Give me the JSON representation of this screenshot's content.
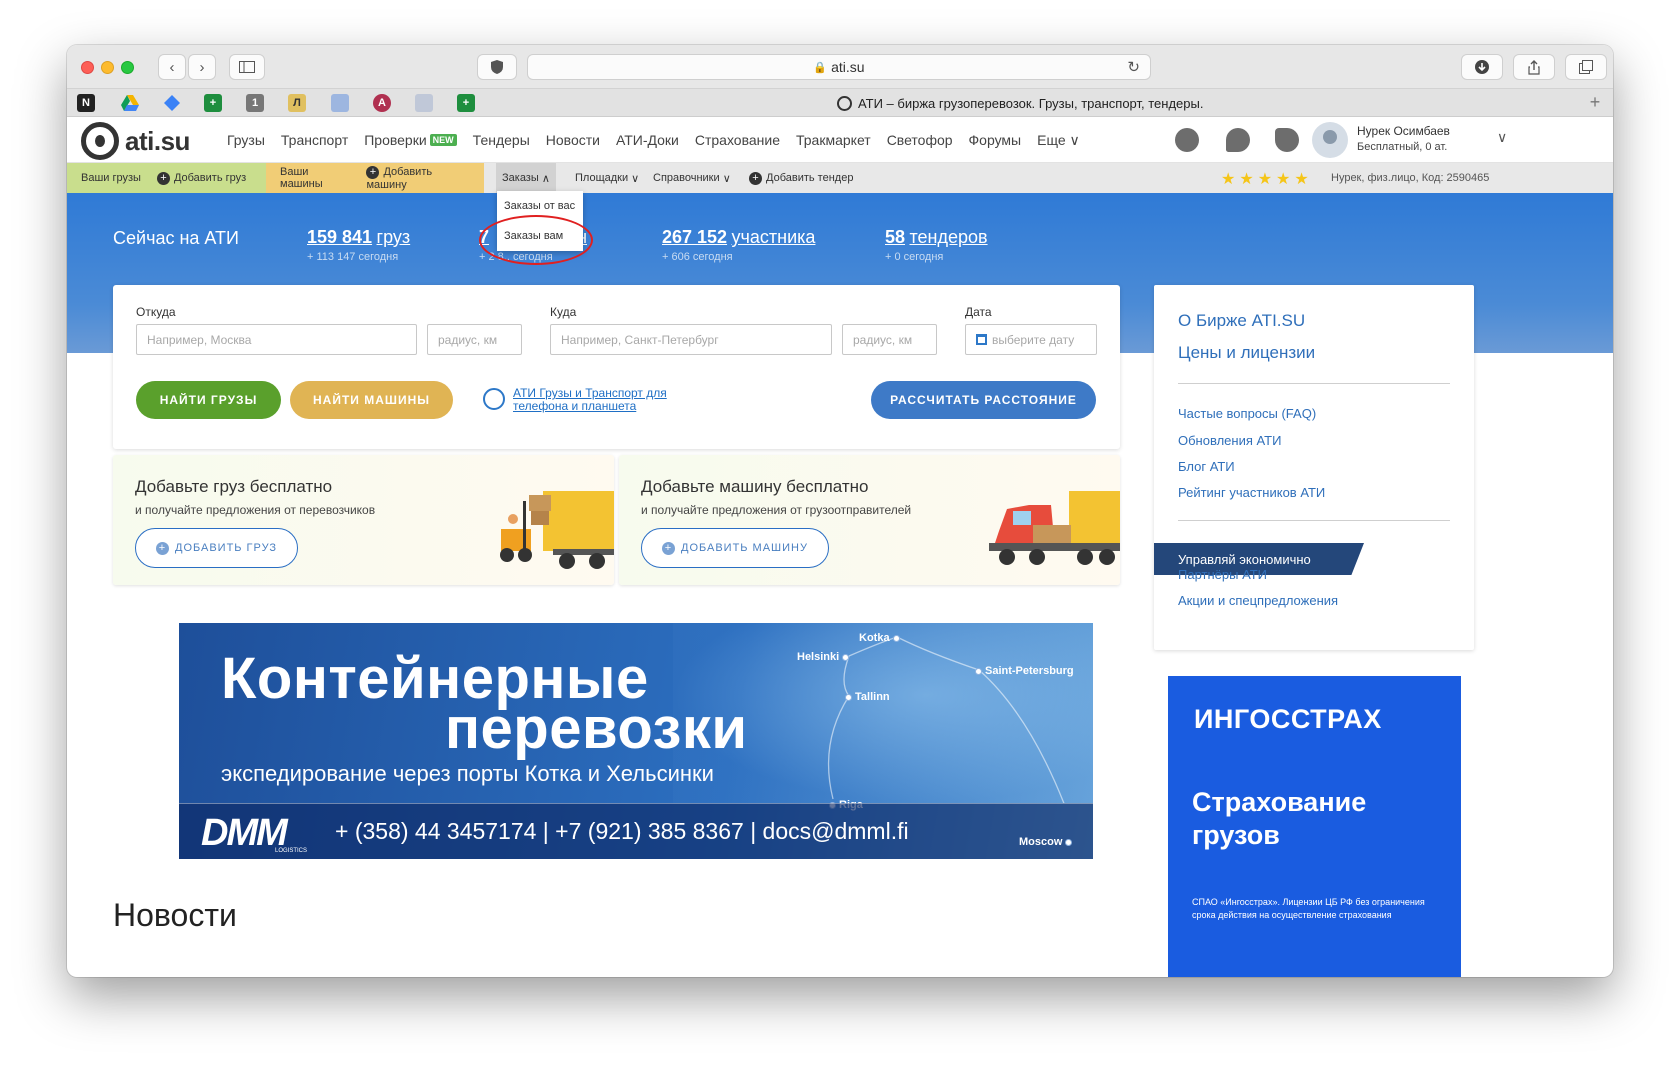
{
  "browser": {
    "url": "ati.su",
    "tab_title": "АТИ – биржа грузоперевозок. Грузы, транспорт, тендеры.",
    "bookmarks": [
      {
        "icon": "notion-icon",
        "label": "N",
        "color": "#222222"
      },
      {
        "icon": "google-drive-icon",
        "label": "",
        "color": "#f4b400"
      },
      {
        "icon": "diamond-icon",
        "label": "",
        "color": "#3b82f6"
      },
      {
        "icon": "sheets-icon",
        "label": "+",
        "color": "#1e8e3e"
      },
      {
        "icon": "numeric-icon",
        "label": "1",
        "color": "#777777"
      },
      {
        "icon": "letter-icon",
        "label": "Л",
        "color": "#e0c060"
      },
      {
        "icon": "grid-icon",
        "label": "",
        "color": "#9db6e0"
      },
      {
        "icon": "a-icon",
        "label": "A",
        "color": "#b03050"
      },
      {
        "icon": "doc-icon",
        "label": "",
        "color": "#c0c8d8"
      },
      {
        "icon": "sheets-icon",
        "label": "+",
        "color": "#1e8e3e"
      }
    ]
  },
  "header": {
    "logo_text": "ati.su",
    "nav": [
      {
        "label": "Грузы",
        "badge": ""
      },
      {
        "label": "Транспорт",
        "badge": ""
      },
      {
        "label": "Проверки",
        "badge": "NEW"
      },
      {
        "label": "Тендеры",
        "badge": ""
      },
      {
        "label": "Новости",
        "badge": ""
      },
      {
        "label": "АТИ-Доки",
        "badge": ""
      },
      {
        "label": "Страхование",
        "badge": ""
      },
      {
        "label": "Тракмаркет",
        "badge": ""
      },
      {
        "label": "Светофор",
        "badge": ""
      },
      {
        "label": "Форумы",
        "badge": ""
      },
      {
        "label": "Еще ∨",
        "badge": ""
      }
    ],
    "user_name": "Нурек Осимбаев",
    "user_plan": "Бесплатный,   0 ат."
  },
  "subnav": {
    "your_cargo": "Ваши грузы",
    "add_cargo": "Добавить груз",
    "your_trucks": "Ваши машины",
    "add_truck": "Добавить машину",
    "orders": "Заказы",
    "platforms": "Площадки",
    "references": "Справочники",
    "add_tender": "Добавить тендер",
    "rating_text": "Нурек, физ.лицо,   Код: 2590465",
    "stars": "★★★★★"
  },
  "orders_dropdown": {
    "items": [
      "Заказы от вас",
      "Заказы вам"
    ]
  },
  "hero": {
    "title": "Сейчас на АТИ",
    "stats": [
      {
        "num": "159 841",
        "label": "груз",
        "sub": "+ 113 147 сегодня"
      },
      {
        "num": "7",
        "label": "ин",
        "sub": "+ 2 8.. сегодня"
      },
      {
        "num": "267 152",
        "label": "участника",
        "sub": "+ 606 сегодня"
      },
      {
        "num": "58",
        "label": "тендеров",
        "sub": "+ 0 сегодня"
      }
    ]
  },
  "search": {
    "from_label": "Откуда",
    "from_placeholder": "Например, Москва",
    "radius_placeholder": "радиус, км",
    "to_label": "Куда",
    "to_placeholder": "Например, Санкт-Петербург",
    "date_label": "Дата",
    "date_placeholder": "выберите дату",
    "find_cargo": "НАЙТИ ГРУЗЫ",
    "find_trucks": "НАЙТИ МАШИНЫ",
    "app_link_line1": "АТИ Грузы и Транспорт для",
    "app_link_line2": "телефона и планшета",
    "calc_distance": "РАССЧИТАТЬ РАССТОЯНИЕ"
  },
  "promo": {
    "cargo_title": "Добавьте груз бесплатно",
    "cargo_sub": "и получайте предложения от перевозчиков",
    "cargo_btn": "ДОБАВИТЬ ГРУЗ",
    "truck_title": "Добавьте машину бесплатно",
    "truck_sub": "и получайте предложения от грузоотправителей",
    "truck_btn": "ДОБАВИТЬ МАШИНУ"
  },
  "banner": {
    "title_line1": "Контейнерные",
    "title_line2": "перевозки",
    "subtitle": "экспедирование через порты Котка и Хельсинки",
    "logo": "DMM",
    "logo_sub": "LOGISTICS",
    "contacts": "+ (358) 44 3457174  |  +7 (921) 385 8367  |  docs@dmml.fi",
    "cities": [
      "Kotka",
      "Helsinki",
      "Saint-Petersburg",
      "Tallinn",
      "Riga",
      "Moscow"
    ]
  },
  "news_heading": "Новости",
  "sidebar": {
    "about": "О Бирже ATI.SU",
    "prices": "Цены и лицензии",
    "links1": [
      "Частые вопросы (FAQ)",
      "Обновления АТИ",
      "Блог АТИ",
      "Рейтинг участников АТИ"
    ],
    "ribbon": "Управляй экономично",
    "links2": [
      "Партнёры АТИ",
      "Акции и спецпредложения"
    ]
  },
  "ingo_ad": {
    "logo": "ИНГОССТРАХ",
    "line1": "Страхование",
    "line2": "грузов",
    "fine": "СПАО «Ингосстрах». Лицензии ЦБ РФ без ограничения срока действия на осуществление страхования"
  }
}
